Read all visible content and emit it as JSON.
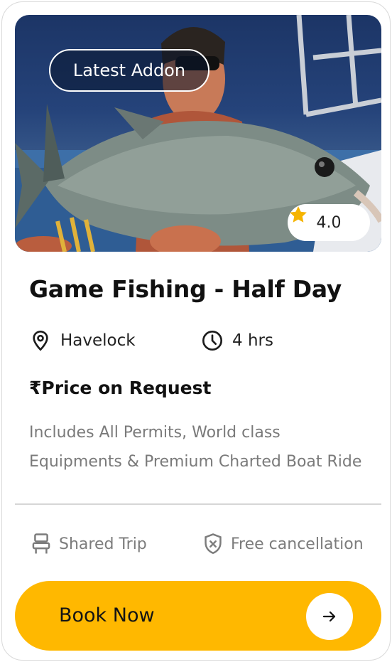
{
  "card": {
    "badge": "Latest Addon",
    "rating": "4.0",
    "title": "Game Fishing - Half Day",
    "location": "Havelock",
    "duration": "4 hrs",
    "price": "₹Price on Request",
    "description": "Includes All Permits, World class Equipments & Premium Charted Boat Ride",
    "features": {
      "shared": "Shared Trip",
      "cancellation": "Free cancellation"
    },
    "cta": "Book Now"
  },
  "icons": {
    "star": "star-icon",
    "location": "location-pin-icon",
    "duration": "clock-icon",
    "shared": "seat-icon",
    "cancellation": "shield-x-icon",
    "cta": "arrow-right-icon"
  },
  "colors": {
    "accent": "#ffb800",
    "star": "#f5b400",
    "muted_text": "#7a7a7a"
  }
}
